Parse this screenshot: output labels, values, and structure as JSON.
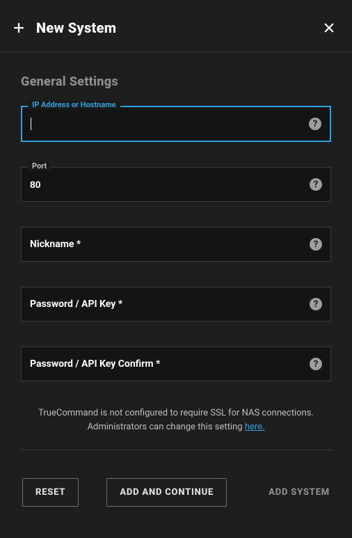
{
  "header": {
    "title": "New System"
  },
  "section_title": "General Settings",
  "fields": {
    "ip": {
      "label": "IP Address or Hostname",
      "value": ""
    },
    "port": {
      "label": "Port",
      "value": "80"
    },
    "nickname": {
      "label": "Nickname *",
      "value": ""
    },
    "password": {
      "label": "Password / API Key *",
      "value": ""
    },
    "password_confirm": {
      "label": "Password / API Key Confirm *",
      "value": ""
    }
  },
  "info": {
    "text_before": "TrueCommand is not configured to require SSL for NAS connections. Administrators can change this setting ",
    "link_text": "here."
  },
  "buttons": {
    "reset": "RESET",
    "add_continue": "ADD AND CONTINUE",
    "add_system": "ADD SYSTEM"
  },
  "help_glyph": "?"
}
